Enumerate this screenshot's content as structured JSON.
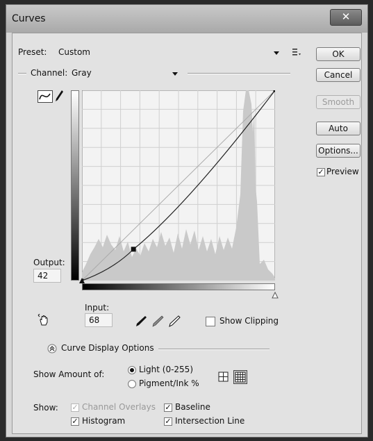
{
  "window": {
    "title": "Curves",
    "close_glyph": "✕"
  },
  "preset": {
    "label": "Preset:",
    "value": "Custom",
    "menu_icon": "preset-menu-icon"
  },
  "channel": {
    "label": "Channel:",
    "value": "Gray"
  },
  "buttons": {
    "ok": "OK",
    "cancel": "Cancel",
    "smooth": "Smooth",
    "auto": "Auto",
    "options": "Options..."
  },
  "preview": {
    "label": "Preview",
    "checked": true
  },
  "output": {
    "label": "Output:",
    "value": "42"
  },
  "input": {
    "label": "Input:",
    "value": "68"
  },
  "show_clipping": {
    "label": "Show Clipping",
    "checked": false
  },
  "curve_display": {
    "label": "Curve Display Options",
    "show_amount_label": "Show Amount of:",
    "light_label": "Light  (0-255)",
    "pigment_label": "Pigment/Ink %",
    "show_label": "Show:",
    "channel_overlays": "Channel Overlays",
    "baseline": "Baseline",
    "histogram": "Histogram",
    "intersection_line": "Intersection Line"
  },
  "curve_points": [
    [
      0,
      0
    ],
    [
      68,
      42
    ],
    [
      255,
      255
    ]
  ]
}
